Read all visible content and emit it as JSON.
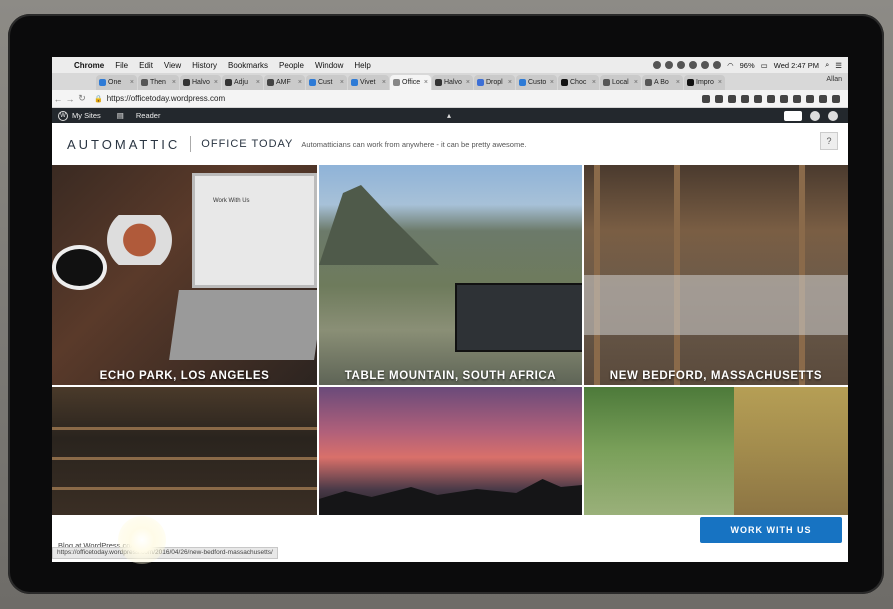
{
  "menubar": {
    "items": [
      "Chrome",
      "File",
      "Edit",
      "View",
      "History",
      "Bookmarks",
      "People",
      "Window",
      "Help"
    ],
    "battery": "96%",
    "clock": "Wed 2:47 PM"
  },
  "tabs": [
    {
      "label": "One",
      "color": "#2e7bd6"
    },
    {
      "label": "Then",
      "color": "#555555"
    },
    {
      "label": "Halvo",
      "color": "#333333"
    },
    {
      "label": "Adju",
      "color": "#333333"
    },
    {
      "label": "AMF",
      "color": "#444444"
    },
    {
      "label": "Cust",
      "color": "#2e7bd6"
    },
    {
      "label": "Vivet",
      "color": "#2e7bd6"
    },
    {
      "label": "Office",
      "color": "#888888",
      "active": true
    },
    {
      "label": "Halvo",
      "color": "#333333"
    },
    {
      "label": "Dropl",
      "color": "#3d6fd6"
    },
    {
      "label": "Custo",
      "color": "#2e7bd6"
    },
    {
      "label": "Choc",
      "color": "#111111"
    },
    {
      "label": "Local",
      "color": "#555555"
    },
    {
      "label": "A Bo",
      "color": "#555555"
    },
    {
      "label": "Impro",
      "color": "#111111"
    }
  ],
  "user_name": "Allan",
  "address": {
    "url": "https://officetoday.wordpress.com"
  },
  "adminbar": {
    "my_sites": "My Sites",
    "reader": "Reader"
  },
  "site": {
    "logo": "AUTOMATTIC",
    "title": "OFFICE TODAY",
    "tagline": "Automatticians can work from anywhere - it can be pretty awesome."
  },
  "tiles": [
    {
      "caption": "ECHO PARK, LOS ANGELES",
      "inner_text": "Work With Us"
    },
    {
      "caption": "TABLE MOUNTAIN, SOUTH AFRICA"
    },
    {
      "caption": "NEW BEDFORD, MASSACHUSETTS"
    },
    {
      "caption": ""
    },
    {
      "caption": ""
    },
    {
      "caption": ""
    }
  ],
  "footer": {
    "blog_at": "Blog at WordPress.com.",
    "work_button": "WORK WITH US",
    "status_url": "https://officetoday.wordpress.com/2016/04/26/new-bedford-massachusetts/"
  }
}
